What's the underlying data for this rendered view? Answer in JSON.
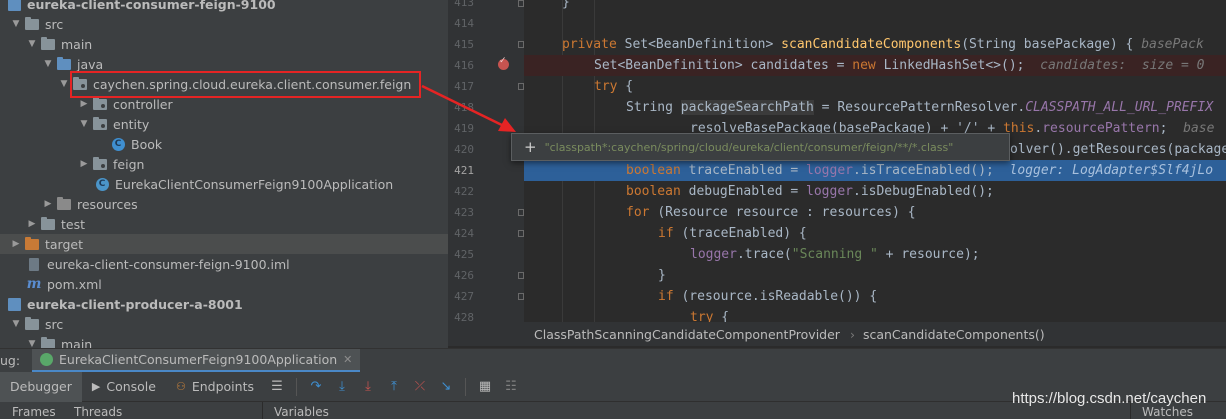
{
  "tree": {
    "rows": [
      {
        "label": "eureka-client-consumer-feign-9100",
        "icon": "module-icon"
      },
      {
        "label": "src",
        "icon": "folder-icon"
      },
      {
        "label": "main",
        "icon": "folder-icon"
      },
      {
        "label": "java",
        "icon": "source-folder-icon"
      },
      {
        "label": "caychen.spring.cloud.eureka.client.consumer.feign",
        "icon": "package-icon"
      },
      {
        "label": "controller",
        "icon": "package-icon"
      },
      {
        "label": "entity",
        "icon": "package-icon"
      },
      {
        "label": "Book",
        "icon": "class-icon"
      },
      {
        "label": "feign",
        "icon": "package-icon"
      },
      {
        "label": "EurekaClientConsumerFeign9100Application",
        "icon": "spring-boot-class-icon"
      },
      {
        "label": "resources",
        "icon": "resources-folder-icon"
      },
      {
        "label": "test",
        "icon": "folder-icon"
      },
      {
        "label": "target",
        "icon": "excluded-folder-icon"
      },
      {
        "label": "eureka-client-consumer-feign-9100.iml",
        "icon": "iml-file-icon"
      },
      {
        "label": "pom.xml",
        "icon": "maven-icon"
      },
      {
        "label": "eureka-client-producer-a-8001",
        "icon": "module-icon"
      },
      {
        "label": "src",
        "icon": "folder-icon"
      },
      {
        "label": "main",
        "icon": "folder-icon"
      }
    ]
  },
  "editor": {
    "line_numbers": [
      "413",
      "414",
      "415",
      "416",
      "417",
      "418",
      "419",
      "420",
      "421",
      "422",
      "423",
      "424",
      "425",
      "426",
      "427",
      "428"
    ],
    "current_line": "421",
    "breakpoint_line": "416"
  },
  "code": {
    "l413": "}",
    "l415_private": "private ",
    "l415_type": "Set<BeanDefinition> ",
    "l415_fn": "scanCandidateComponents",
    "l415_params": "(String basePackage) { ",
    "l415_hint": "basePack",
    "l416_decl": "Set<BeanDefinition> candidates = ",
    "l416_new": "new ",
    "l416_rest": "LinkedHashSet<>();  ",
    "l416_hint": "candidates:  size = 0",
    "l417_try": "try",
    "l417_brace": " {",
    "l418_type": "String ",
    "l418_var": "packageSearchPath",
    "l418_mid": " = ResourcePatternResolver.",
    "l418_const": "CLASSPATH_ALL_URL_PREFIX",
    "l419_a": "resolveBasePackage(basePackage) + '/' + ",
    "l419_this": "this",
    "l419_b": ".",
    "l419_field": "resourcePattern",
    "l419_c": ";  ",
    "l419_hint": "base",
    "l420_text": "olver().getResources(packageSea",
    "l421_kw": "boolean ",
    "l421_a": "traceEnabled = ",
    "l421_field": "logger",
    "l421_b": ".isTraceEnabled();  ",
    "l421_hint": "logger: LogAdapter$Slf4jLo",
    "l422_kw": "boolean ",
    "l422_a": "debugEnabled = ",
    "l422_field": "logger",
    "l422_b": ".isDebugEnabled();",
    "l423_for": "for ",
    "l423_a": "(Resource resource : resources) {",
    "l424_if": "if ",
    "l424_a": "(traceEnabled) {",
    "l425_field": "logger",
    "l425_a": ".trace(",
    "l425_str": "\"Scanning \"",
    "l425_b": " + resource);",
    "l426": "}",
    "l427_if": "if ",
    "l427_a": "(resource.isReadable()) {",
    "l428_try": "try",
    "l428_brace": " {"
  },
  "tooltip": {
    "expand_label": "+",
    "value": "\"classpath*:caychen/spring/cloud/eureka/client/consumer/feign/**/*.class\""
  },
  "breadcrumb": {
    "class_name": "ClassPathScanningCandidateComponentProvider",
    "method_name": "scanCandidateComponents()"
  },
  "debug": {
    "panel_label": "ug:",
    "run_config": "EurekaClientConsumerFeign9100Application",
    "tabs": {
      "debugger": "Debugger",
      "console": "Console",
      "endpoints": "Endpoints"
    },
    "panes": {
      "frames": "Frames",
      "threads": "Threads",
      "variables": "Variables",
      "watches": "Watches"
    }
  },
  "watermark": "https://blog.csdn.net/caychen",
  "colors": {
    "keyword": "#cc7832",
    "method": "#ffc66d",
    "string": "#6a8759",
    "field": "#9876aa",
    "current_line": "#2d6099",
    "highlight_box": "#e52424"
  }
}
